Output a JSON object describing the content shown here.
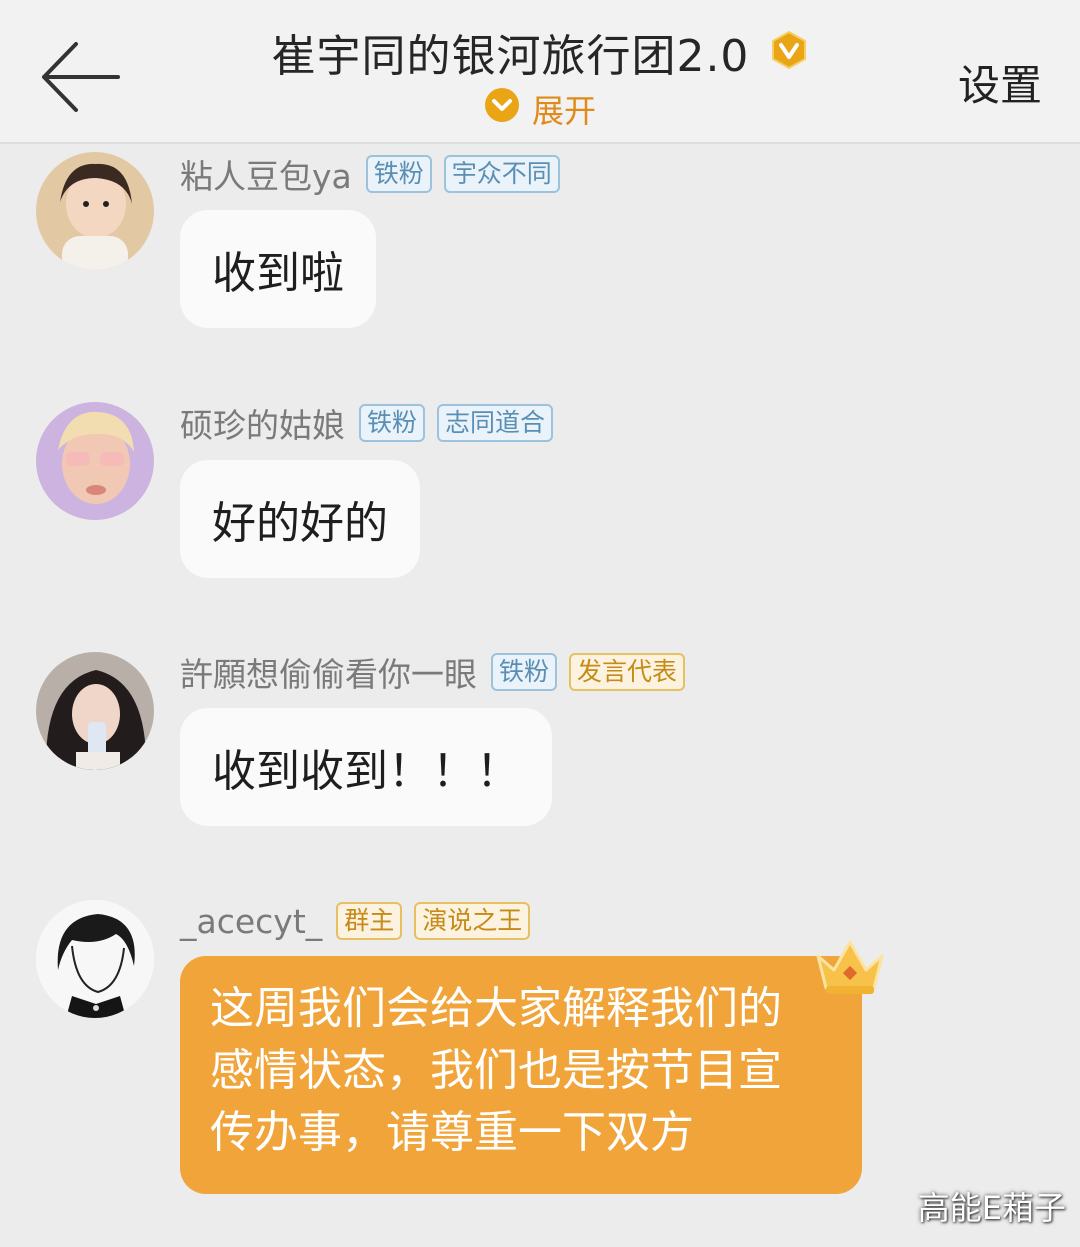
{
  "header": {
    "title": "崔宇同的银河旅行团2.0",
    "expand_label": "展开",
    "settings_label": "设置"
  },
  "messages": [
    {
      "username": "粘人豆包ya",
      "tags": [
        "铁粉",
        "宇众不同"
      ],
      "text": "收到啦"
    },
    {
      "username": "硕珍的姑娘",
      "tags": [
        "铁粉",
        "志同道合"
      ],
      "text": "好的好的"
    },
    {
      "username": "許願想偷偷看你一眼",
      "tags": [
        "铁粉",
        "发言代表"
      ],
      "text": "收到收到！！！"
    },
    {
      "username": "_acecyt_",
      "tags": [
        "群主",
        "演说之王"
      ],
      "lines": [
        "这周我们会给大家解释我们的",
        "感情状态，我们也是按节目宣",
        "传办事，请尊重一下双方"
      ]
    }
  ],
  "watermark": "高能E葙子",
  "colors": {
    "accent": "#f0a43a",
    "badge_gold": "#e9a516",
    "tag_blue": "#5a8fb5",
    "tag_gold": "#c78a16"
  }
}
